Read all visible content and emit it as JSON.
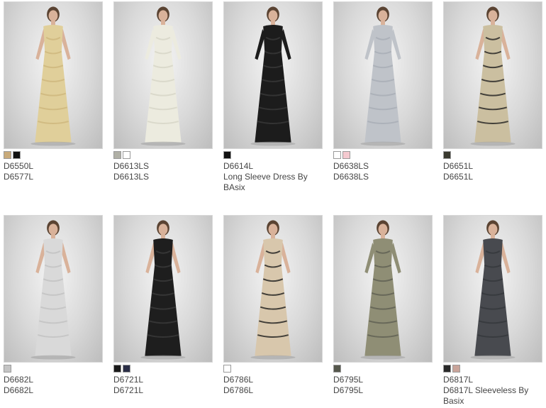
{
  "products": [
    {
      "line1": "D6550L",
      "line2": "D6577L",
      "swatches": [
        "#c8aa7a",
        "#111111"
      ],
      "dress": "#e0cf9a",
      "dress_accent": "#cdb57c",
      "sleeves": false
    },
    {
      "line1": "D6613LS",
      "line2": "D6613LS",
      "swatches": [
        "#b0b0a6",
        "#ffffff"
      ],
      "dress": "#ecebdf",
      "dress_accent": "#d6d4c6",
      "sleeves": true
    },
    {
      "line1": "D6614L",
      "line2": "Long Sleeve Dress By BAsix",
      "swatches": [
        "#111111"
      ],
      "dress": "#1c1c1c",
      "dress_accent": "#3a3a3a",
      "sleeves": true
    },
    {
      "line1": "D6638LS",
      "line2": "D6638LS",
      "swatches": [
        "#ffffff",
        "#f4c9cf"
      ],
      "dress": "#bfc3c9",
      "dress_accent": "#a7adb5",
      "sleeves": true
    },
    {
      "line1": "D6651L",
      "line2": "D6651L",
      "swatches": [
        "#3a3a30"
      ],
      "dress": "#cbbfa0",
      "dress_accent": "#1f1f1f",
      "sleeves": false
    },
    {
      "line1": "D6682L",
      "line2": "D6682L",
      "swatches": [
        "#c4c4c4"
      ],
      "dress": "#d9d9d9",
      "dress_accent": "#c0c0c0",
      "sleeves": false
    },
    {
      "line1": "D6721L",
      "line2": "D6721L",
      "swatches": [
        "#1a1a1a",
        "#2a2d45"
      ],
      "dress": "#1e1e1e",
      "dress_accent": "#3b3b3b",
      "sleeves": false
    },
    {
      "line1": "D6786L",
      "line2": "D6786L",
      "swatches": [
        "#ffffff"
      ],
      "dress": "#d8c7ac",
      "dress_accent": "#1b1b1b",
      "sleeves": false
    },
    {
      "line1": "D6795L",
      "line2": "D6795L",
      "swatches": [
        "#55574c"
      ],
      "dress": "#8f8e75",
      "dress_accent": "#5e5f52",
      "sleeves": true
    },
    {
      "line1": "D6817L",
      "line2": "D6817L Sleeveless By Basix",
      "swatches": [
        "#2a2a2a",
        "#c9a49a"
      ],
      "dress": "#484a4f",
      "dress_accent": "#35373b",
      "sleeves": false
    }
  ]
}
